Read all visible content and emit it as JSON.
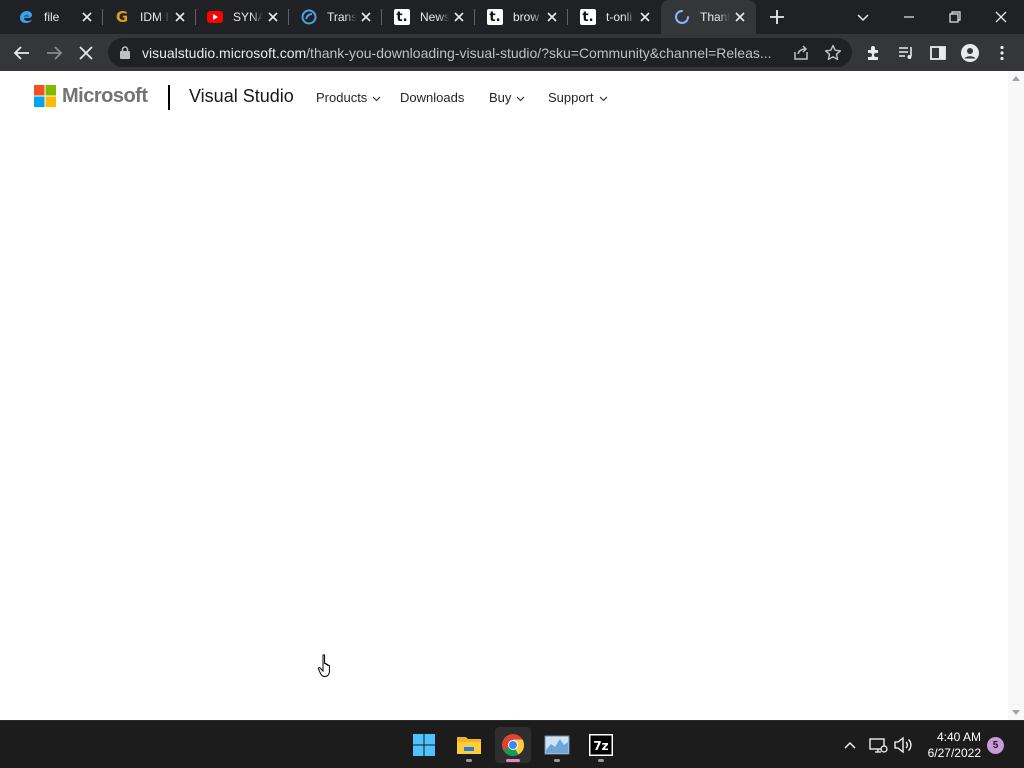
{
  "browser": {
    "tabs": [
      {
        "title": "file",
        "favicon": "edge-icon",
        "active": false
      },
      {
        "title": "IDM I",
        "favicon": "g-icon",
        "active": false
      },
      {
        "title": "SYNA",
        "favicon": "youtube-icon",
        "active": false
      },
      {
        "title": "Trans",
        "favicon": "translate-icon",
        "active": false
      },
      {
        "title": "News",
        "favicon": "t-online-icon",
        "active": false
      },
      {
        "title": "brow",
        "favicon": "t-online-icon",
        "active": false
      },
      {
        "title": "t-onli",
        "favicon": "t-online-icon",
        "active": false
      },
      {
        "title": "Thank",
        "favicon": "loading-spinner-icon",
        "active": true
      }
    ],
    "url": {
      "host": "visualstudio.microsoft.com",
      "path": "/thank-you-downloading-visual-studio/?sku=Community&channel=Releas..."
    },
    "loading": true
  },
  "page": {
    "brand": "Microsoft",
    "product": "Visual Studio",
    "nav": [
      {
        "label": "Products",
        "dropdown": true
      },
      {
        "label": "Downloads",
        "dropdown": false
      },
      {
        "label": "Buy",
        "dropdown": true
      },
      {
        "label": "Support",
        "dropdown": true
      }
    ]
  },
  "taskbar": {
    "apps": [
      "start-icon",
      "file-explorer-icon",
      "chrome-icon",
      "resource-monitor-icon",
      "7zip-icon"
    ],
    "active_app": "chrome-icon",
    "time": "4:40 AM",
    "date": "6/27/2022",
    "notification_count": "5"
  },
  "colors": {
    "tabstrip_bg": "#202124",
    "toolbar_bg": "#35363a",
    "page_bg": "#ffffff",
    "taskbar_bg": "#1c1c1c",
    "notification_badge": "#c79bd6"
  }
}
